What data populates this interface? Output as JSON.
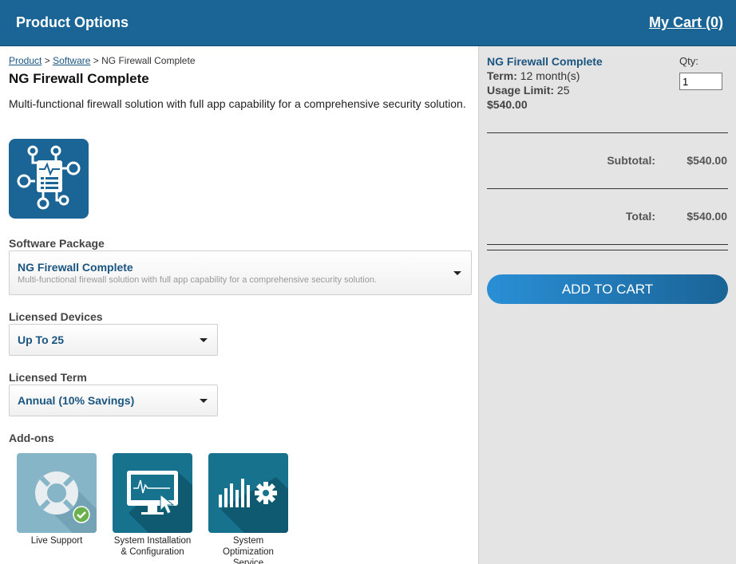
{
  "header": {
    "title": "Product Options",
    "cart_link": "My Cart (0)"
  },
  "breadcrumb": {
    "items": [
      "Product",
      "Software"
    ],
    "separator": ">",
    "current": "NG Firewall Complete"
  },
  "product": {
    "title": "NG Firewall Complete",
    "description": "Multi-functional firewall solution with full app capability for a comprehensive security solution.",
    "image_icon": "network-document-icon"
  },
  "options": {
    "package": {
      "label": "Software Package",
      "value": "NG Firewall Complete",
      "sub": "Multi-functional firewall solution with full app capability for a comprehensive security solution."
    },
    "devices": {
      "label": "Licensed Devices",
      "value": "Up To 25"
    },
    "term": {
      "label": "Licensed Term",
      "value": "Annual (10% Savings)"
    }
  },
  "addons": {
    "label": "Add-ons",
    "items": [
      {
        "name": "Live Support",
        "icon": "lifebuoy-icon",
        "selected": true
      },
      {
        "name": "System Installation & Configuration",
        "icon": "monitor-cursor-icon",
        "selected": false
      },
      {
        "name": "System Optimization Service",
        "icon": "bars-gear-icon",
        "selected": false
      }
    ]
  },
  "cart": {
    "item_name": "NG Firewall Complete",
    "term_label": "Term:",
    "term_value": "12 month(s)",
    "usage_label": "Usage Limit:",
    "usage_value": "25",
    "price": "$540.00",
    "qty_label": "Qty:",
    "qty_value": "1",
    "subtotal_label": "Subtotal:",
    "subtotal_value": "$540.00",
    "total_label": "Total:",
    "total_value": "$540.00",
    "add_button": "ADD TO CART"
  },
  "colors": {
    "header_bg": "#1a6496",
    "link": "#1a5580",
    "panel_bg": "#e4e4e4",
    "addon_teal": "#17728e",
    "addon_support": "#87b5c8",
    "check_green": "#6ab04c"
  }
}
